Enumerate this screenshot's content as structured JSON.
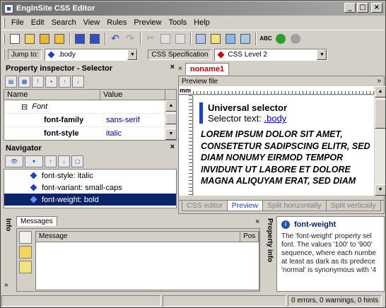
{
  "app": {
    "title": "EngInSite CSS Editor"
  },
  "window_controls": {
    "minimize": "_",
    "maximize": "□",
    "close": "×"
  },
  "menu": [
    "File",
    "Edit",
    "Search",
    "View",
    "Rules",
    "Preview",
    "Tools",
    "Help"
  ],
  "toolbar": {
    "icons": [
      "new-icon",
      "open-icon",
      "open-folder-icon",
      "open-recent-icon",
      "save-icon",
      "save-all-icon",
      "undo-icon",
      "redo-icon",
      "cut-icon",
      "copy-icon",
      "paste-icon",
      "preview-icon",
      "edit-icon",
      "validate-icon",
      "properties-icon",
      "spellcheck-icon",
      "back-icon",
      "forward-icon"
    ],
    "spellcheck_label": "ABC"
  },
  "jump": {
    "label": "Jump to:",
    "selector_value": ".body",
    "spec_label": "CSS Specification",
    "spec_value": "CSS Level 2",
    "selector_color": "#1a3fd1",
    "spec_color": "#cc0000"
  },
  "inspector": {
    "title": "Property inspector - Selector",
    "close": "×",
    "columns": [
      "Name",
      "Value"
    ],
    "group": {
      "toggle": "⊟",
      "name": "Font"
    },
    "rows": [
      {
        "name": "font-family",
        "value": "sans-serif"
      },
      {
        "name": "font-style",
        "value": "italic"
      }
    ]
  },
  "navigator": {
    "title": "Navigator",
    "close": "×",
    "items": [
      {
        "label": "font-style: italic",
        "selected": false
      },
      {
        "label": "font-variant: small-caps",
        "selected": false
      },
      {
        "label": "font-weight: bold",
        "selected": true
      }
    ]
  },
  "editor": {
    "tab_close": "×",
    "tab_name": "noname1",
    "preview_label": "Preview file",
    "more": "»",
    "ruler_unit": "mm",
    "preview": {
      "heading": "Universal selector",
      "selector_prefix": "Selector text:",
      "selector_link": ".body",
      "lorem": "LOREM IPSUM DOLOR SIT AMET, CONSETETUR SADIPSCING ELITR, SED DIAM NONUMY EIRMOD TEMPOR INVIDUNT UT LABORE ET DOLORE MAGNA ALIQUYAM ERAT, SED DIAM"
    },
    "view_tabs": [
      {
        "label": "CSS editor",
        "active": false
      },
      {
        "label": "Preview",
        "active": true
      },
      {
        "label": "Split horizontally",
        "active": false
      },
      {
        "label": "Split vertically",
        "active": false
      }
    ]
  },
  "bottom": {
    "info_label": "Info",
    "messages_tab": "Messages",
    "message_columns": [
      "Message",
      "Pos"
    ],
    "close": "×",
    "property_info_label": "Property info",
    "property_info": {
      "title": "font-weight",
      "description": "The 'font-weight' property sel\nfont. The values '100' to '900'\nsequence, where each numbe\nat least as dark as its predece\n'normal' is synonymous with '4"
    }
  },
  "status": {
    "summary": "0 errors, 0 warnings, 0 hints"
  }
}
